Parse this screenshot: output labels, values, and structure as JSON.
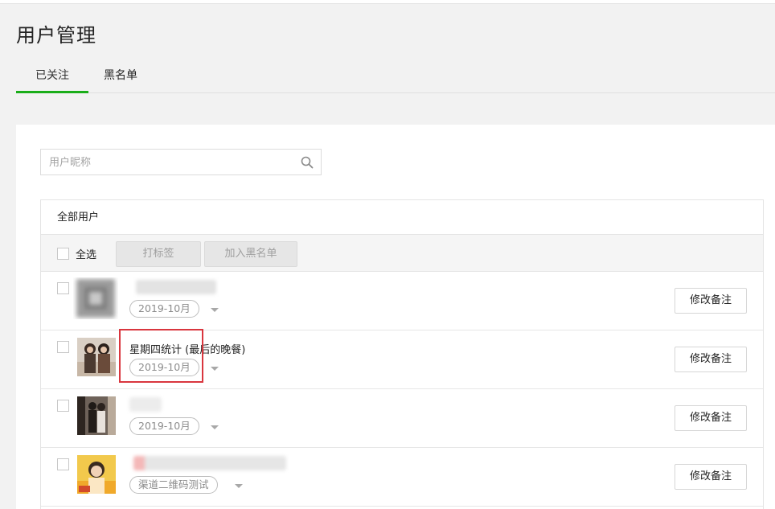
{
  "page": {
    "title": "用户管理"
  },
  "tabs": [
    {
      "label": "已关注",
      "active": true
    },
    {
      "label": "黑名单",
      "active": false
    }
  ],
  "search": {
    "placeholder": "用户昵称",
    "value": ""
  },
  "list": {
    "header": "全部用户",
    "toolbar": {
      "select_all_label": "全选",
      "tag_button": "打标签",
      "blacklist_button": "加入黑名单"
    },
    "users": [
      {
        "nickname": "",
        "tag": "2019-10月",
        "remark_button": "修改备注"
      },
      {
        "nickname": "星期四统计 (最后的晚餐)",
        "tag": "2019-10月",
        "remark_button": "修改备注"
      },
      {
        "nickname": "",
        "tag": "2019-10月",
        "remark_button": "修改备注"
      },
      {
        "nickname": "",
        "tag": "渠道二维码测试",
        "remark_button": "修改备注"
      }
    ]
  },
  "colors": {
    "accent": "#1aad19",
    "highlight": "#d9363e"
  }
}
